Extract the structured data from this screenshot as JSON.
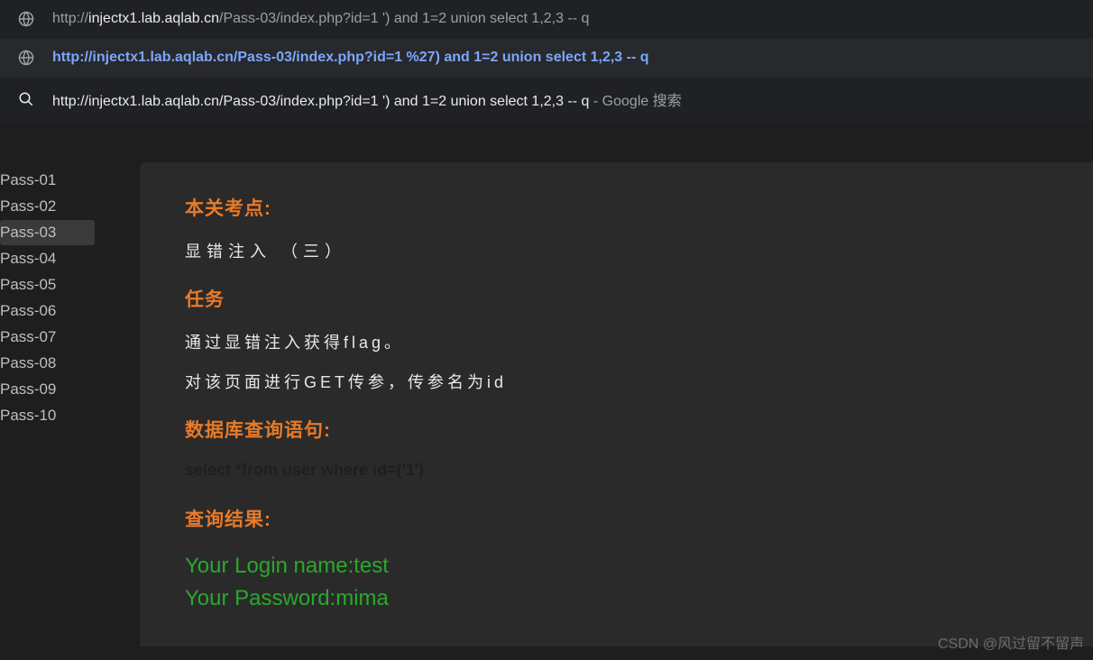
{
  "omnibox": {
    "row1": {
      "prefix": "http://",
      "highlighted": "injectx1.lab.aqlab.cn",
      "rest": "/Pass-03/index.php?id=1 ') and 1=2 union select 1,2,3 -- q"
    },
    "row2": {
      "text": "http://injectx1.lab.aqlab.cn/Pass-03/index.php?id=1 %27) and 1=2 union select 1,2,3 -- q"
    },
    "row3": {
      "text": "http://injectx1.lab.aqlab.cn/Pass-03/index.php?id=1 ') and 1=2 union select 1,2,3 -- q",
      "suffix": " - Google 搜索"
    }
  },
  "sidebar": {
    "items": [
      "Pass-01",
      "Pass-02",
      "Pass-03",
      "Pass-04",
      "Pass-05",
      "Pass-06",
      "Pass-07",
      "Pass-08",
      "Pass-09",
      "Pass-10"
    ],
    "activeIndex": 2
  },
  "content": {
    "heading1": "本关考点:",
    "line1": "显错注入 （三）",
    "heading2": "任务",
    "line2": "通过显错注入获得flag。",
    "line3": "对该页面进行GET传参，传参名为id",
    "heading3": "数据库查询语句:",
    "sql": "select *from user where id=('1')",
    "heading4": "查询结果:",
    "result1": "Your Login name:test",
    "result2": "Your Password:mima"
  },
  "watermark": "CSDN @风过留不留声"
}
